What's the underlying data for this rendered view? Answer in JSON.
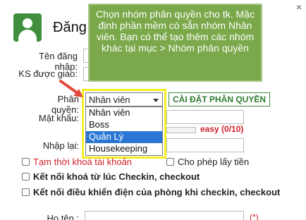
{
  "dialog": {
    "title": "Đăng",
    "close_symbol": "×"
  },
  "form": {
    "username_label": "Tên đăng nhập:",
    "ks_label": "KS được giao:",
    "permission_label": "Phân quyền:",
    "password_label": "Mật khẩu:",
    "repeat_label": "Nhập lại:",
    "fullname_label": "Họ tên :",
    "password_strength": "easy (0/10)",
    "required_mark": "(*)",
    "settings_button": "CÀI ĐẶT PHÂN QUYỀN"
  },
  "permission_select": {
    "selected_value": "Nhân viên",
    "options": [
      "Nhân viên",
      "Boss",
      "Quản Lý",
      "Housekeeping"
    ],
    "highlighted_option": "Quản Lý"
  },
  "checkboxes": {
    "locked_account": "Tạm thời khoá tài khoản",
    "cash_permission": "Cho phép lấy tiền",
    "lock_on_checkin": "Kết nối khoá từ lúc Checkin, checkout",
    "power_on_checkin": "Kết nối điều khiển điện của phòng khi checkin, checkout"
  },
  "tooltip": {
    "text": "Chọn nhóm phân quyền cho tk. Mặc định phần mềm có sẵn nhóm Nhân viên. Bạn có thể tạo thêm các nhóm khác tại mục > Nhóm phân quyền"
  },
  "colors": {
    "tooltip_bg": "#7aa84a",
    "highlight_yellow": "#f3ee24",
    "arrow_red": "#e24a3b",
    "accent_green": "#2e7d32",
    "selection_blue": "#2b78d4",
    "error_red": "#d0202a"
  },
  "icons": {
    "user_icon": "user-avatar-icon",
    "close_icon": "close-icon",
    "arrow": "annotation-arrow-icon"
  }
}
